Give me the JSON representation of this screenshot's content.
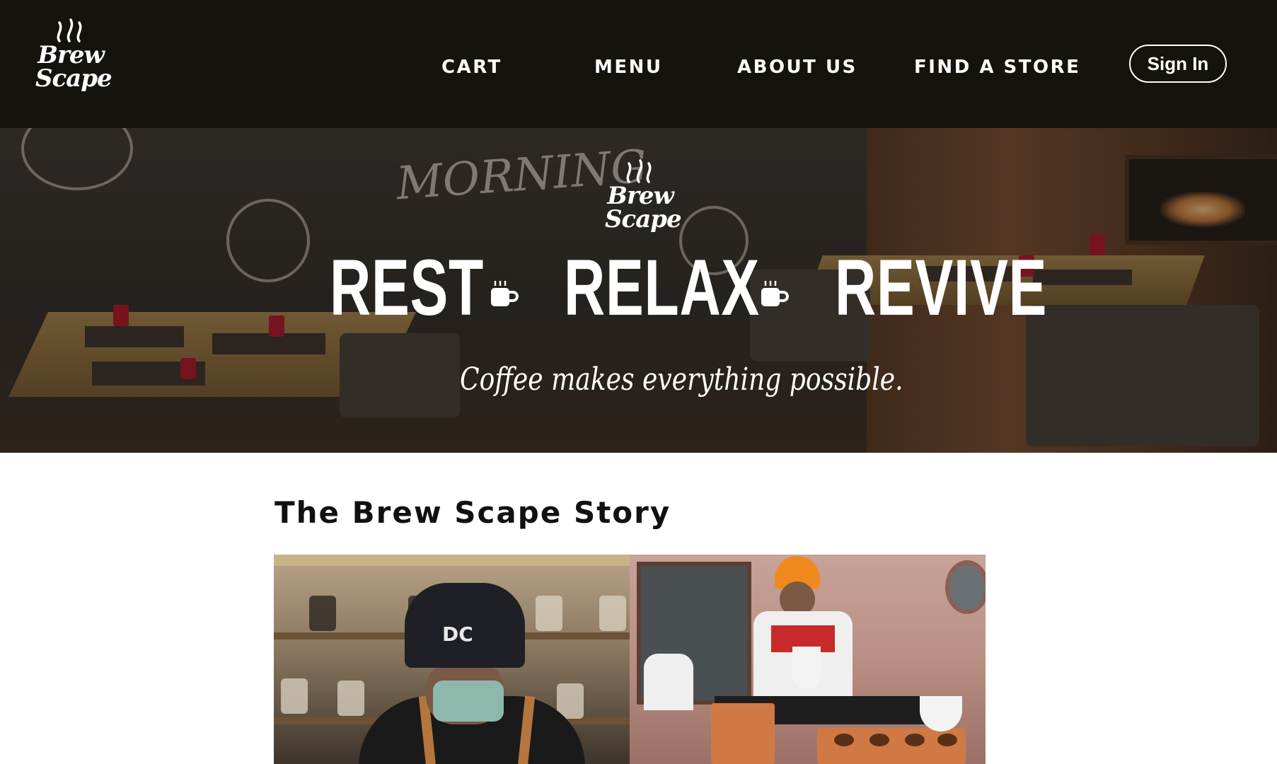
{
  "brand": {
    "name_line1": "Brew",
    "name_line2": "Scape"
  },
  "nav": {
    "items": [
      {
        "label": "CART"
      },
      {
        "label": "MENU"
      },
      {
        "label": "ABOUT US"
      },
      {
        "label": "FIND A STORE"
      }
    ],
    "sign_in_label": "Sign In"
  },
  "hero": {
    "mural_text": "MORNING",
    "logo_line1": "Brew",
    "logo_line2": "Scape",
    "words": [
      "REST",
      "RELAX",
      "REVIVE"
    ],
    "separator_icon": "coffee-cup-icon",
    "tagline": "Coffee makes everything possible."
  },
  "story": {
    "title": "The Brew Scape Story",
    "photos": [
      {
        "icon": "barista-cap-photo",
        "cap_logo": "DC"
      },
      {
        "icon": "barista-pour-over-photo"
      }
    ]
  },
  "colors": {
    "nav_bg": "#16130f",
    "text_light": "#ffffff",
    "text_dark": "#111111"
  }
}
